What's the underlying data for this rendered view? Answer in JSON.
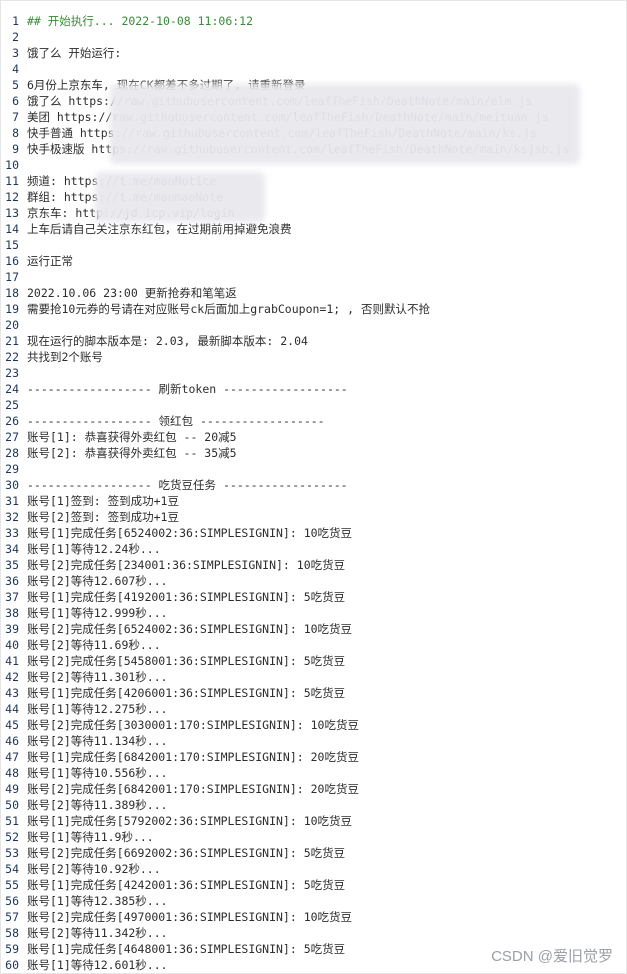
{
  "lines": [
    {
      "n": "1",
      "t": "## 开始执行... 2022-10-08 11:06:12",
      "cls": "comment"
    },
    {
      "n": "2",
      "t": ""
    },
    {
      "n": "3",
      "t": "饿了么 开始运行:"
    },
    {
      "n": "4",
      "t": ""
    },
    {
      "n": "5",
      "t": "6月份上京东车, 现在CK都差不多过期了, 请重新登录"
    },
    {
      "n": "6",
      "t": "饿了么 https://raw.githubusercontent.com/leafTheFish/DeathNote/main/elm.js"
    },
    {
      "n": "7",
      "t": "美团 https://raw.githubusercontent.com/leafTheFish/DeathNote/main/meituan.js"
    },
    {
      "n": "8",
      "t": "快手普通 https://raw.githubusercontent.com/leafTheFish/DeathNote/main/ks.js"
    },
    {
      "n": "9",
      "t": "快手极速版 https://raw.githubusercontent.com/leafTheFish/DeathNote/main/ksjsb.js"
    },
    {
      "n": "10",
      "t": ""
    },
    {
      "n": "11",
      "t": "频道: https://t.me/maoNotice"
    },
    {
      "n": "12",
      "t": "群组: https://t.me/maomaoNote"
    },
    {
      "n": "13",
      "t": "京东车: http://jd.icp.vip/login"
    },
    {
      "n": "14",
      "t": "上车后请自己关注京东红包，在过期前用掉避免浪费"
    },
    {
      "n": "15",
      "t": ""
    },
    {
      "n": "16",
      "t": "运行正常"
    },
    {
      "n": "17",
      "t": ""
    },
    {
      "n": "18",
      "t": "2022.10.06 23:00 更新抢券和笔笔返"
    },
    {
      "n": "19",
      "t": "需要抢10元券的号请在对应账号ck后面加上grabCoupon=1; , 否则默认不抢"
    },
    {
      "n": "20",
      "t": ""
    },
    {
      "n": "21",
      "t": "现在运行的脚本版本是: 2.03, 最新脚本版本: 2.04"
    },
    {
      "n": "22",
      "t": "共找到2个账号"
    },
    {
      "n": "23",
      "t": ""
    },
    {
      "n": "24",
      "t": "------------------ 刷新token ------------------"
    },
    {
      "n": "25",
      "t": ""
    },
    {
      "n": "26",
      "t": "------------------ 领红包 ------------------"
    },
    {
      "n": "27",
      "t": "账号[1]: 恭喜获得外卖红包 -- 20减5"
    },
    {
      "n": "28",
      "t": "账号[2]: 恭喜获得外卖红包 -- 35减5"
    },
    {
      "n": "29",
      "t": ""
    },
    {
      "n": "30",
      "t": "------------------ 吃货豆任务 ------------------"
    },
    {
      "n": "31",
      "t": "账号[1]签到: 签到成功+1豆"
    },
    {
      "n": "32",
      "t": "账号[2]签到: 签到成功+1豆"
    },
    {
      "n": "33",
      "t": "账号[1]完成任务[6524002:36:SIMPLESIGNIN]: 10吃货豆"
    },
    {
      "n": "34",
      "t": "账号[1]等待12.24秒..."
    },
    {
      "n": "35",
      "t": "账号[2]完成任务[234001:36:SIMPLESIGNIN]: 10吃货豆"
    },
    {
      "n": "36",
      "t": "账号[2]等待12.607秒..."
    },
    {
      "n": "37",
      "t": "账号[1]完成任务[4192001:36:SIMPLESIGNIN]: 5吃货豆"
    },
    {
      "n": "38",
      "t": "账号[1]等待12.999秒..."
    },
    {
      "n": "39",
      "t": "账号[2]完成任务[6524002:36:SIMPLESIGNIN]: 10吃货豆"
    },
    {
      "n": "40",
      "t": "账号[2]等待11.69秒..."
    },
    {
      "n": "41",
      "t": "账号[2]完成任务[5458001:36:SIMPLESIGNIN]: 5吃货豆"
    },
    {
      "n": "42",
      "t": "账号[2]等待11.301秒..."
    },
    {
      "n": "43",
      "t": "账号[1]完成任务[4206001:36:SIMPLESIGNIN]: 5吃货豆"
    },
    {
      "n": "44",
      "t": "账号[1]等待12.275秒..."
    },
    {
      "n": "45",
      "t": "账号[2]完成任务[3030001:170:SIMPLESIGNIN]: 10吃货豆"
    },
    {
      "n": "46",
      "t": "账号[2]等待11.134秒..."
    },
    {
      "n": "47",
      "t": "账号[1]完成任务[6842001:170:SIMPLESIGNIN]: 20吃货豆"
    },
    {
      "n": "48",
      "t": "账号[1]等待10.556秒..."
    },
    {
      "n": "49",
      "t": "账号[2]完成任务[6842001:170:SIMPLESIGNIN]: 20吃货豆"
    },
    {
      "n": "50",
      "t": "账号[2]等待11.389秒..."
    },
    {
      "n": "51",
      "t": "账号[1]完成任务[5792002:36:SIMPLESIGNIN]: 10吃货豆"
    },
    {
      "n": "52",
      "t": "账号[1]等待11.9秒..."
    },
    {
      "n": "53",
      "t": "账号[2]完成任务[6692002:36:SIMPLESIGNIN]: 5吃货豆"
    },
    {
      "n": "54",
      "t": "账号[2]等待10.92秒..."
    },
    {
      "n": "55",
      "t": "账号[1]完成任务[4242001:36:SIMPLESIGNIN]: 5吃货豆"
    },
    {
      "n": "56",
      "t": "账号[1]等待12.385秒..."
    },
    {
      "n": "57",
      "t": "账号[2]完成任务[4970001:36:SIMPLESIGNIN]: 10吃货豆"
    },
    {
      "n": "58",
      "t": "账号[2]等待11.342秒..."
    },
    {
      "n": "59",
      "t": "账号[1]完成任务[4648001:36:SIMPLESIGNIN]: 5吃货豆"
    },
    {
      "n": "60",
      "t": "账号[1]等待12.601秒..."
    }
  ],
  "watermark": "CSDN @爱旧觉罗"
}
